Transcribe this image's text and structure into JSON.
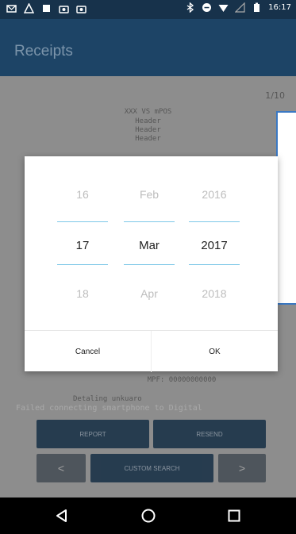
{
  "status_bar": {
    "time": "16:17",
    "left_icons": [
      "mail-icon",
      "warning-icon",
      "square-icon",
      "camera-icon",
      "camera-icon"
    ],
    "right_icons": [
      "bluetooth-icon",
      "minus-circle-icon",
      "wifi-icon",
      "signal-icon",
      "battery-icon"
    ]
  },
  "app_bar": {
    "title": "Receipts"
  },
  "receipt": {
    "pager": "1/10",
    "lines": [
      "XXX VS mPOS",
      "Header",
      "Header",
      "Header"
    ],
    "lower_lines": [
      "MPF:       00000000000",
      "Detaling unkuaro"
    ]
  },
  "toast": {
    "text": "Failed connecting smartphone to Digital"
  },
  "buttons": {
    "report": "REPORT",
    "resend": "RESEND",
    "prev": "<",
    "custom_search": "CUSTOM SEARCH",
    "next": ">"
  },
  "date_picker": {
    "day": {
      "prev": "16",
      "selected": "17",
      "next": "18"
    },
    "month": {
      "prev": "Feb",
      "selected": "Mar",
      "next": "Apr"
    },
    "year": {
      "prev": "2016",
      "selected": "2017",
      "next": "2018"
    },
    "cancel_label": "Cancel",
    "ok_label": "OK"
  },
  "navbar": {
    "icons": [
      "back-icon",
      "home-icon",
      "recents-icon"
    ]
  }
}
